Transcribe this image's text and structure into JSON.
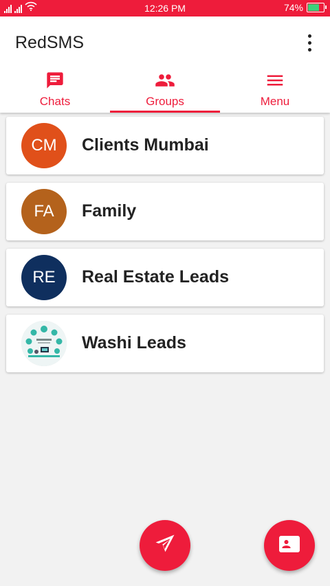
{
  "status_bar": {
    "time": "12:26 PM",
    "battery_percent": "74%",
    "battery_level": 0.74
  },
  "app": {
    "title": "RedSMS",
    "overflow_icon": "more-vert-icon"
  },
  "tabs": [
    {
      "label": "Chats",
      "icon": "chat-icon",
      "active": false
    },
    {
      "label": "Groups",
      "icon": "group-icon",
      "active": true
    },
    {
      "label": "Menu",
      "icon": "menu-icon",
      "active": false
    }
  ],
  "groups": [
    {
      "initials": "CM",
      "name": "Clients Mumbai",
      "color": "#e0501a"
    },
    {
      "initials": "FA",
      "name": "Family",
      "color": "#b4621c"
    },
    {
      "initials": "RE",
      "name": "Real Estate Leads",
      "color": "#0f2f5e"
    },
    {
      "initials": "",
      "name": "Washi Leads",
      "color": "#ffffff"
    }
  ],
  "fabs": {
    "send_icon": "send-icon",
    "contacts_icon": "contact-card-icon"
  },
  "colors": {
    "accent": "#ee1c3b",
    "battery": "#3dd17a"
  }
}
